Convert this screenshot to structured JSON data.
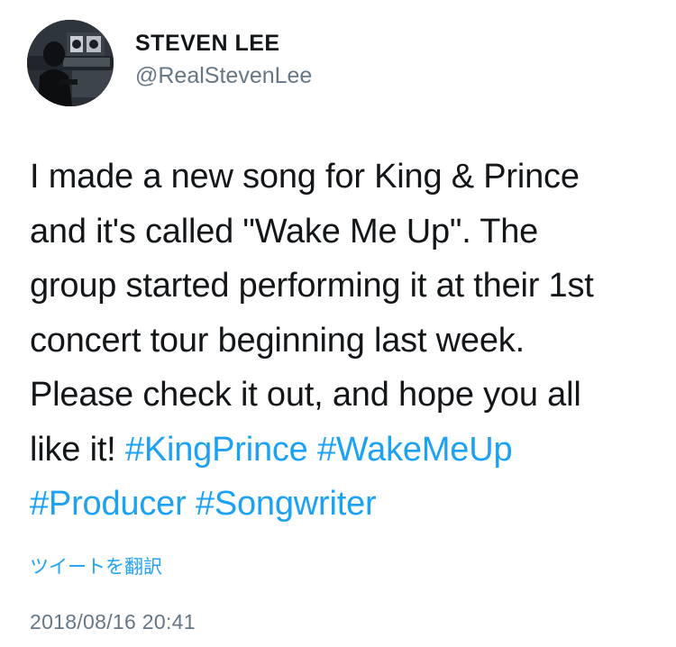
{
  "user": {
    "display_name": "STEVEN LEE",
    "handle": "@RealStevenLee",
    "avatar_icon": "profile-photo-studio"
  },
  "tweet": {
    "lines": [
      "I made a new song for King & Prince",
      "and it's called \"Wake Me Up\". The",
      "group started performing it at their 1st",
      "concert tour beginning last week.",
      "Please check it out, and hope you all"
    ],
    "last_line_prefix": "like it! ",
    "hashtags": [
      "#KingPrince",
      "#WakeMeUp",
      "#Producer",
      "#Songwriter"
    ]
  },
  "translate_label": "ツイートを翻訳",
  "timestamp": "2018/08/16 20:41",
  "colors": {
    "link": "#1da1f2",
    "text": "#14171a",
    "muted": "#657786"
  }
}
